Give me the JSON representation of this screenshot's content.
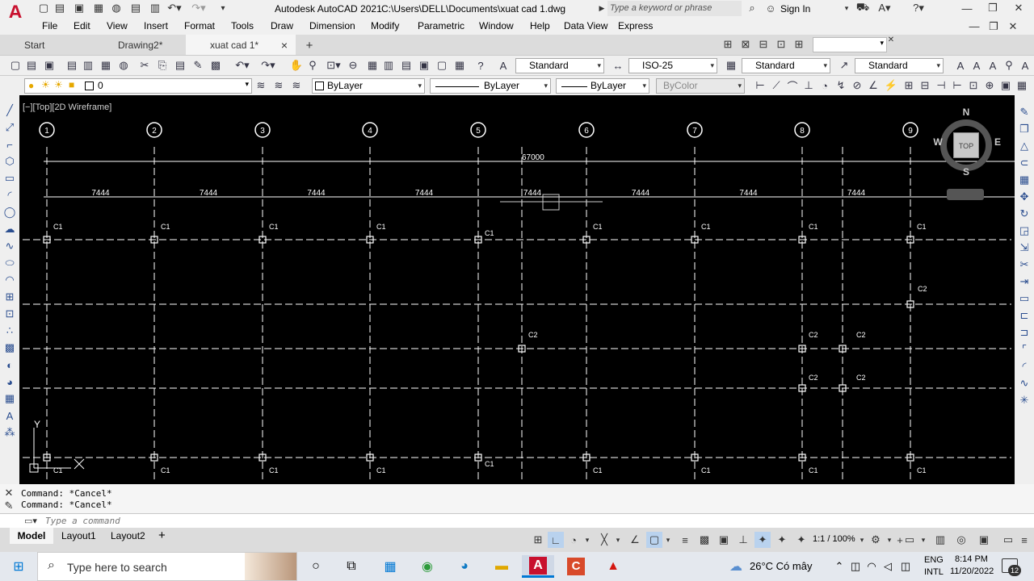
{
  "title_bar": {
    "app": "Autodesk AutoCAD 2021",
    "file_path": "C:\\Users\\DELL\\Documents\\xuat cad 1.dwg",
    "search_placeholder": "Type a keyword or phrase",
    "sign_in": "Sign In",
    "logo_letter": "A"
  },
  "menu": [
    "File",
    "Edit",
    "View",
    "Insert",
    "Format",
    "Tools",
    "Draw",
    "Dimension",
    "Modify",
    "Parametric",
    "Window",
    "Help",
    "Data View",
    "Express"
  ],
  "tabs": [
    {
      "label": "Start",
      "close": ""
    },
    {
      "label": "Drawing2*",
      "close": "×"
    },
    {
      "label": "xuat cad 1*",
      "close": "×"
    }
  ],
  "tab_add": "+",
  "styles": {
    "text_style": "Standard",
    "dim_style": "ISO-25",
    "table_style": "Standard",
    "mleader_style": "Standard"
  },
  "layers": {
    "current_layer": "0",
    "color": "ByLayer",
    "linetype": "ByLayer",
    "lineweight": "ByLayer",
    "plotstyle": "ByColor"
  },
  "viewport": {
    "label": "[−][Top][2D Wireframe]",
    "total_dim": "67000",
    "bay_dim": "7444",
    "grid_bubbles": [
      "1",
      "2",
      "3",
      "4",
      "5",
      "6",
      "7",
      "8",
      "9"
    ],
    "col_c1": "C1",
    "col_c2": "C2",
    "ucs_y": "Y"
  },
  "viewcube": {
    "n": "N",
    "s": "S",
    "e": "E",
    "w": "W",
    "top": "TOP"
  },
  "command": {
    "history": [
      "Command: *Cancel*",
      "Command: *Cancel*"
    ],
    "placeholder": "Type a command"
  },
  "layout_tabs": [
    "Model",
    "Layout1",
    "Layout2"
  ],
  "layout_add": "+",
  "status": {
    "scale": "1:1 / 100%"
  },
  "taskbar": {
    "search_placeholder": "Type here to search",
    "weather": "26°C  Có mây",
    "lang1": "ENG",
    "lang2": "INTL",
    "time": "8:14 PM",
    "date": "11/20/2022",
    "notif_count": "12"
  },
  "colors": {
    "accent_red": "#c8102e",
    "viewport_bg": "#000000",
    "grid_line": "#ffffff"
  }
}
